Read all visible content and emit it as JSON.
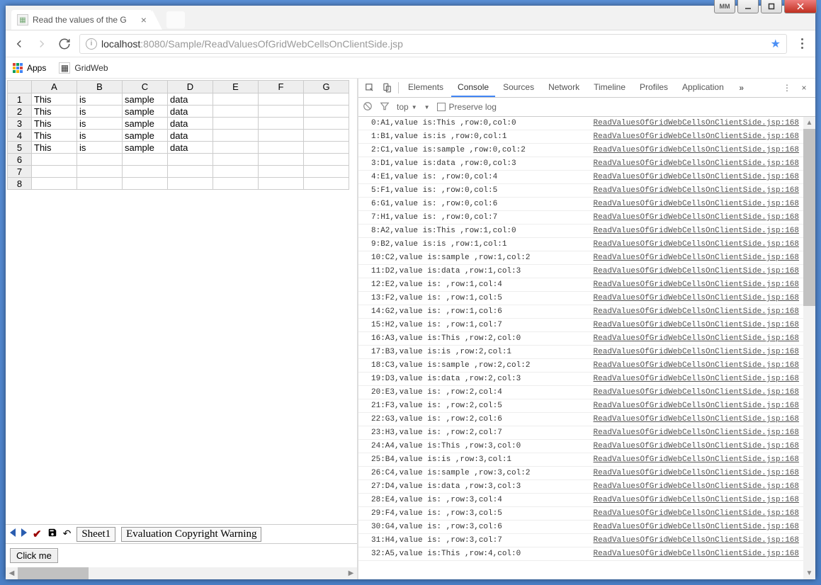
{
  "window": {
    "mm_label": "MM"
  },
  "tab": {
    "title": "Read the values of the G"
  },
  "url": {
    "host": "localhost",
    "port_and_path": ":8080/Sample/ReadValuesOfGridWebCellsOnClientSide.jsp"
  },
  "bookmarks": {
    "apps": "Apps",
    "gridweb": "GridWeb"
  },
  "grid": {
    "columns": [
      "A",
      "B",
      "C",
      "D",
      "E",
      "F",
      "G"
    ],
    "row_headers": [
      "1",
      "2",
      "3",
      "4",
      "5",
      "6",
      "7",
      "8"
    ],
    "rows": [
      [
        "This",
        "is",
        "sample",
        "data",
        "",
        "",
        ""
      ],
      [
        "This",
        "is",
        "sample",
        "data",
        "",
        "",
        ""
      ],
      [
        "This",
        "is",
        "sample",
        "data",
        "",
        "",
        ""
      ],
      [
        "This",
        "is",
        "sample",
        "data",
        "",
        "",
        ""
      ],
      [
        "This",
        "is",
        "sample",
        "data",
        "",
        "",
        ""
      ],
      [
        "",
        "",
        "",
        "",
        "",
        "",
        ""
      ],
      [
        "",
        "",
        "",
        "",
        "",
        "",
        ""
      ],
      [
        "",
        "",
        "",
        "",
        "",
        "",
        ""
      ]
    ],
    "footer": {
      "sheet": "Sheet1",
      "evaluation": "Evaluation Copyright Warning"
    },
    "button": "Click me"
  },
  "devtools": {
    "tabs": [
      "Elements",
      "Console",
      "Sources",
      "Network",
      "Timeline",
      "Profiles",
      "Application"
    ],
    "active_tab": "Console",
    "filter": {
      "top": "top",
      "preserve": "Preserve log"
    }
  },
  "console_source": "ReadValuesOfGridWebCellsOnClientSide.jsp:168",
  "console_lines": [
    "0:A1,value is:This ,row:0,col:0",
    "1:B1,value is:is ,row:0,col:1",
    "2:C1,value is:sample ,row:0,col:2",
    "3:D1,value is:data ,row:0,col:3",
    "4:E1,value is: ,row:0,col:4",
    "5:F1,value is: ,row:0,col:5",
    "6:G1,value is: ,row:0,col:6",
    "7:H1,value is: ,row:0,col:7",
    "8:A2,value is:This ,row:1,col:0",
    "9:B2,value is:is ,row:1,col:1",
    "10:C2,value is:sample ,row:1,col:2",
    "11:D2,value is:data ,row:1,col:3",
    "12:E2,value is: ,row:1,col:4",
    "13:F2,value is: ,row:1,col:5",
    "14:G2,value is: ,row:1,col:6",
    "15:H2,value is: ,row:1,col:7",
    "16:A3,value is:This ,row:2,col:0",
    "17:B3,value is:is ,row:2,col:1",
    "18:C3,value is:sample ,row:2,col:2",
    "19:D3,value is:data ,row:2,col:3",
    "20:E3,value is: ,row:2,col:4",
    "21:F3,value is: ,row:2,col:5",
    "22:G3,value is: ,row:2,col:6",
    "23:H3,value is: ,row:2,col:7",
    "24:A4,value is:This ,row:3,col:0",
    "25:B4,value is:is ,row:3,col:1",
    "26:C4,value is:sample ,row:3,col:2",
    "27:D4,value is:data ,row:3,col:3",
    "28:E4,value is: ,row:3,col:4",
    "29:F4,value is: ,row:3,col:5",
    "30:G4,value is: ,row:3,col:6",
    "31:H4,value is: ,row:3,col:7",
    "32:A5,value is:This ,row:4,col:0"
  ]
}
